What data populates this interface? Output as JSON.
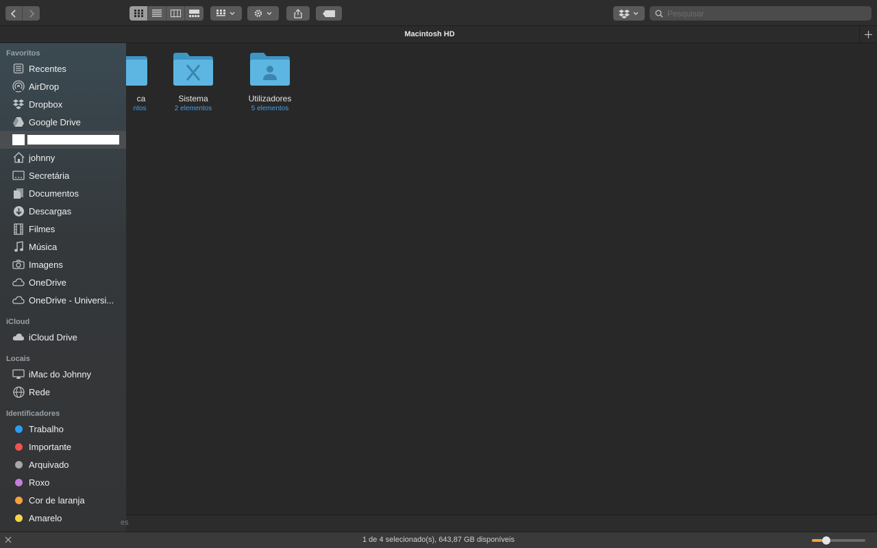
{
  "window": {
    "title": "Macintosh HD"
  },
  "toolbar": {
    "search_placeholder": "Pesquisar",
    "view_mode_active": "icons"
  },
  "files": [
    {
      "name": "ca",
      "subtitle": "ntos"
    },
    {
      "name": "Sistema",
      "subtitle": "2 elementos"
    },
    {
      "name": "Utilizadores",
      "subtitle": "5 elementos"
    }
  ],
  "sidebar": {
    "sections": {
      "favoritos": "Favoritos",
      "icloud": "iCloud",
      "locais": "Locais",
      "identificadores": "Identificadores"
    },
    "favoritos": [
      "Recentes",
      "AirDrop",
      "Dropbox",
      "Google Drive",
      "johnny",
      "Secretária",
      "Documentos",
      "Descargas",
      "Filmes",
      "Música",
      "Imagens",
      "OneDrive",
      "OneDrive - Universi..."
    ],
    "icloud": [
      "iCloud Drive"
    ],
    "locais": [
      "iMac do Johnny",
      "Rede"
    ],
    "tags": [
      {
        "label": "Trabalho",
        "color": "#2d9cf3"
      },
      {
        "label": "Importante",
        "color": "#f0524f"
      },
      {
        "label": "Arquivado",
        "color": "#a7a7a7"
      },
      {
        "label": "Roxo",
        "color": "#c77de0"
      },
      {
        "label": "Cor de laranja",
        "color": "#f7a13c"
      },
      {
        "label": "Amarelo",
        "color": "#f5d547"
      }
    ]
  },
  "pathbar": {
    "text": "es"
  },
  "status": {
    "text": "1 de 4 selecionado(s), 643,87 GB disponíveis",
    "zoom_fraction": 0.27
  },
  "colors": {
    "accent": "#4a9ee6",
    "slider": "#f2a33a"
  }
}
